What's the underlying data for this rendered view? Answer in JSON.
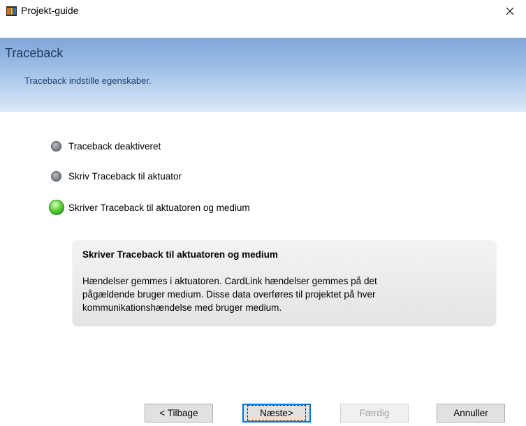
{
  "window": {
    "title": "Projekt-guide"
  },
  "header": {
    "title": "Traceback",
    "subtitle": "Traceback indstille egenskaber."
  },
  "options": [
    {
      "label": "Traceback deaktiveret",
      "selected": false
    },
    {
      "label": "Skriv Traceback til aktuator",
      "selected": false
    },
    {
      "label": "Skriver Traceback til aktuatoren og medium",
      "selected": true
    }
  ],
  "description": {
    "title": "Skriver Traceback til aktuatoren og medium",
    "lines": [
      "Hændelser gemmes i aktuatoren. CardLink hændelser gemmes på det",
      "pågældende bruger medium. Disse data overføres til projektet på hver",
      "kommunikationshændelse med bruger medium."
    ]
  },
  "buttons": {
    "back": "< Tilbage",
    "next": "Næste>",
    "finish": "Færdig",
    "cancel": "Annuller"
  },
  "colors": {
    "header_gradient_top": "#7ea6d8",
    "header_gradient_bottom": "#dce8f7",
    "header_title": "#1c3b66",
    "selected_radio": "#4cc22e",
    "focus_border": "#0078d7"
  },
  "icons": {
    "app": "project-wizard-icon",
    "close": "close-icon"
  }
}
